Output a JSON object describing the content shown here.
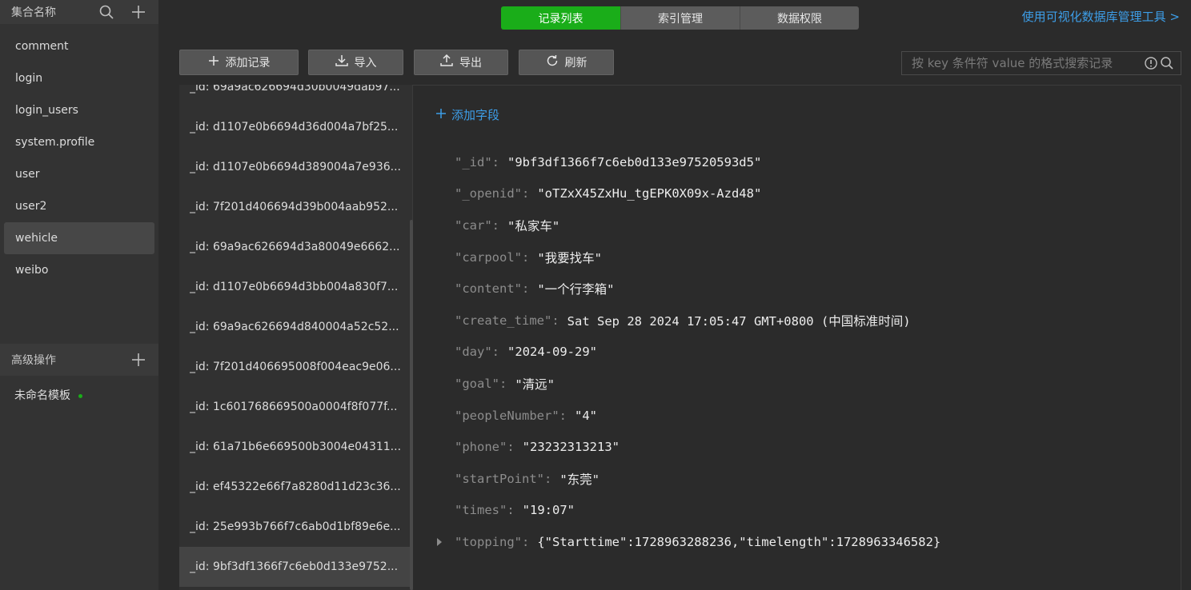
{
  "sidebar": {
    "header": "集合名称",
    "collections": [
      "comment",
      "login",
      "login_users",
      "system.profile",
      "user",
      "user2",
      "wehicle",
      "weibo"
    ],
    "active_collection": "wehicle",
    "advanced_header": "高级操作",
    "template_item": "未命名模板"
  },
  "tabs": [
    {
      "label": "记录列表"
    },
    {
      "label": "索引管理"
    },
    {
      "label": "数据权限"
    }
  ],
  "vis_link": "使用可视化数据库管理工具 >",
  "toolbar": {
    "add": "添加记录",
    "import": "导入",
    "export": "导出",
    "refresh": "刷新"
  },
  "search": {
    "placeholder": "按 key 条件符 value 的格式搜索记录"
  },
  "records": [
    "_id: 69a9ac626694d30b0049dab97...",
    "_id: d1107e0b6694d36d004a7bf25...",
    "_id: d1107e0b6694d389004a7e936...",
    "_id: 7f201d406694d39b004aab952...",
    "_id: 69a9ac626694d3a80049e6662...",
    "_id: d1107e0b6694d3bb004a830f7...",
    "_id: 69a9ac626694d840004a52c52...",
    "_id: 7f201d406695008f004eac9e06...",
    "_id: 1c601768669500a0004f8f077f...",
    "_id: 61a71b6e669500b3004e04311...",
    "_id: ef45322e66f7a8280d11d23c36...",
    "_id: 25e993b766f7c6ab0d1bf89e6e...",
    "_id: 9bf3df1366f7c6eb0d133e9752..."
  ],
  "detail": {
    "add_field": "添加字段",
    "fields": [
      {
        "key": "\"_id\"",
        "value": "\"9bf3df1366f7c6eb0d133e97520593d5\""
      },
      {
        "key": "\"_openid\"",
        "value": "\"oTZxX45ZxHu_tgEPK0X09x-Azd48\""
      },
      {
        "key": "\"car\"",
        "value": "\"私家车\""
      },
      {
        "key": "\"carpool\"",
        "value": "\"我要找车\""
      },
      {
        "key": "\"content\"",
        "value": "\"一个行李箱\""
      },
      {
        "key": "\"create_time\"",
        "value": "Sat Sep 28 2024 17:05:47 GMT+0800 (中国标准时间)"
      },
      {
        "key": "\"day\"",
        "value": "\"2024-09-29\""
      },
      {
        "key": "\"goal\"",
        "value": "\"清远\""
      },
      {
        "key": "\"peopleNumber\"",
        "value": "\"4\""
      },
      {
        "key": "\"phone\"",
        "value": "\"23232313213\""
      },
      {
        "key": "\"startPoint\"",
        "value": "\"东莞\""
      },
      {
        "key": "\"times\"",
        "value": "\"19:07\""
      },
      {
        "key": "\"topping\"",
        "value": "{\"Starttime\":1728963288236,\"timelength\":1728963346582}"
      }
    ]
  },
  "colors": {
    "accent_green": "#1aad19",
    "link_blue": "#3d9ee8"
  }
}
